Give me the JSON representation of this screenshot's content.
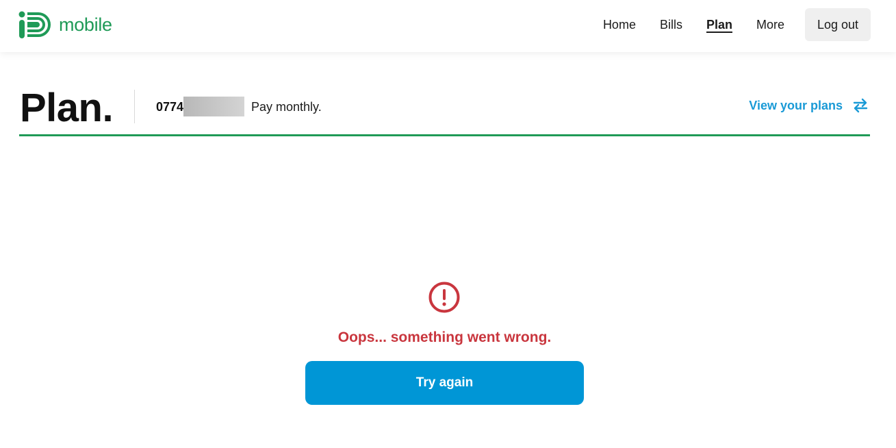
{
  "brand": {
    "logo_text": "mobile",
    "logo_icon": "id-logo-icon",
    "color": "#1f9a57"
  },
  "nav": {
    "items": [
      {
        "label": "Home",
        "active": false
      },
      {
        "label": "Bills",
        "active": false
      },
      {
        "label": "Plan",
        "active": true
      },
      {
        "label": "More",
        "active": false
      }
    ],
    "logout_label": "Log out"
  },
  "page": {
    "title": "Plan.",
    "phone_number_visible": "0774",
    "plan_type": "Pay monthly.",
    "view_plans_label": "View your plans",
    "view_plans_icon": "swap-arrows-icon",
    "accent_color": "#1a9ad6"
  },
  "error": {
    "icon": "exclamation-circle-icon",
    "message": "Oops... something went wrong.",
    "retry_label": "Try again",
    "color": "#c9363e",
    "button_color": "#0096d6"
  }
}
